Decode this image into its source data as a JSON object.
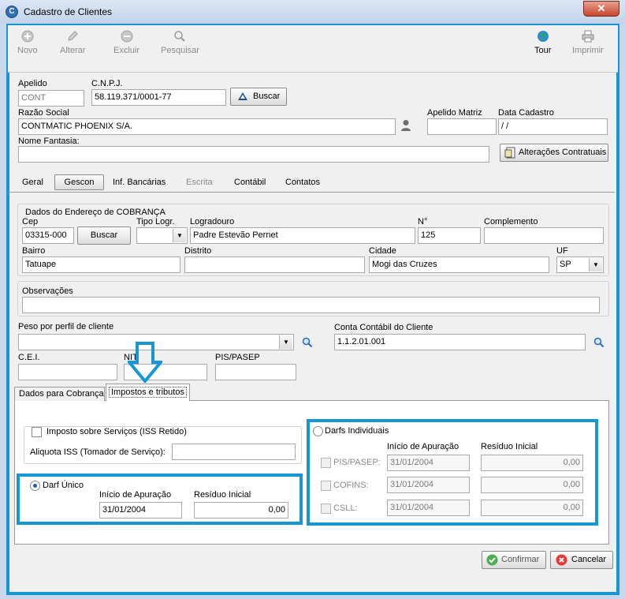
{
  "window": {
    "title": "Cadastro de Clientes",
    "close": "✕"
  },
  "toolbar": {
    "novo": "Novo",
    "alterar": "Alterar",
    "excluir": "Excluir",
    "pesquisar": "Pesquisar",
    "tour": "Tour",
    "imprimir": "Imprimir"
  },
  "header": {
    "apelido_label": "Apelido",
    "apelido": "CONT",
    "cnpj_label": "C.N.P.J.",
    "cnpj": "58.119.371/0001-77",
    "buscar": "Buscar",
    "razao_label": "Razão Social",
    "razao": "CONTMATIC PHOENIX S/A.",
    "apelido_matriz_label": "Apelido Matriz",
    "apelido_matriz": "",
    "data_cadastro_label": "Data Cadastro",
    "data_cadastro": " /  /",
    "fantasia_label": "Nome Fantasia:",
    "fantasia": "",
    "alteracoes": "Alterações Contratuais"
  },
  "tabs": [
    "Geral",
    "Gescon",
    "Inf. Bancárias",
    "Escrita",
    "Contábil",
    "Contatos"
  ],
  "endereco": {
    "title": "Dados do Endereço de COBRANÇA",
    "cep_label": "Cep",
    "cep": "03315-000",
    "buscar": "Buscar",
    "tipo_label": "Tipo Logr.",
    "tipo": "",
    "logradouro_label": "Logradouro",
    "logradouro": "Padre Estevão Pernet",
    "numero_label": "N°",
    "numero": "125",
    "complemento_label": "Complemento",
    "complemento": "",
    "bairro_label": "Bairro",
    "bairro": "Tatuape",
    "distrito_label": "Distrito",
    "distrito": "",
    "cidade_label": "Cidade",
    "cidade": "Mogi das Cruzes",
    "uf_label": "UF",
    "uf": "SP"
  },
  "observacoes": {
    "label": "Observações",
    "value": ""
  },
  "peso": {
    "label": "Peso por perfil de cliente",
    "value": ""
  },
  "conta": {
    "label": "Conta Contábil do Cliente",
    "value": "1.1.2.01.001"
  },
  "cei": {
    "label": "C.E.I.",
    "value": ""
  },
  "nit": {
    "label": "NIT",
    "value": ""
  },
  "pis": {
    "label": "PIS/PASEP",
    "value": ""
  },
  "subtabs": [
    "Dados para Cobrança",
    "Impostos e tributos"
  ],
  "impostos": {
    "iss_label": "Imposto sobre Serviços (ISS Retido)",
    "aliquota_label": "Aliquota ISS (Tomador de Serviço):",
    "aliquota": "",
    "darf_unico": "Darf Único",
    "inicio_label": "Início de Apuração",
    "residuo_label": "Resíduo Inicial",
    "darf_inicio": "31/01/2004",
    "darf_residuo": "0,00",
    "darfs_individuais": "Darfs Individuais",
    "rows": [
      {
        "label": "PIS/PASEP:",
        "inicio": "31/01/2004",
        "residuo": "0,00"
      },
      {
        "label": "COFINS:",
        "inicio": "31/01/2004",
        "residuo": "0,00"
      },
      {
        "label": "CSLL:",
        "inicio": "31/01/2004",
        "residuo": "0,00"
      }
    ]
  },
  "footer": {
    "confirmar": "Confirmar",
    "cancelar": "Cancelar"
  },
  "colors": {
    "highlight": "#1596d6",
    "titlebar": "#c9d7e8"
  }
}
